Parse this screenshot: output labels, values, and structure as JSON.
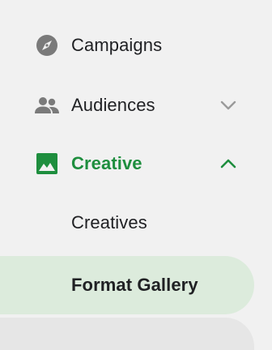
{
  "nav": {
    "items": [
      {
        "label": "Campaigns",
        "icon": "compass-icon",
        "selected": false
      },
      {
        "label": "Audiences",
        "icon": "people-icon",
        "expand": "chevron-down-icon",
        "selected": false
      },
      {
        "label": "Creative",
        "icon": "image-icon",
        "expand": "chevron-up-icon",
        "expanded": true,
        "active": true,
        "children": [
          {
            "label": "Creatives",
            "selected": false
          },
          {
            "label": "Format Gallery",
            "selected": true
          }
        ]
      }
    ]
  },
  "colors": {
    "background": "#f1f1f1",
    "active_green": "#1e8e3e",
    "selected_bg": "#dcebdc",
    "icon_gray": "#7a7a7a",
    "text": "#202124"
  }
}
